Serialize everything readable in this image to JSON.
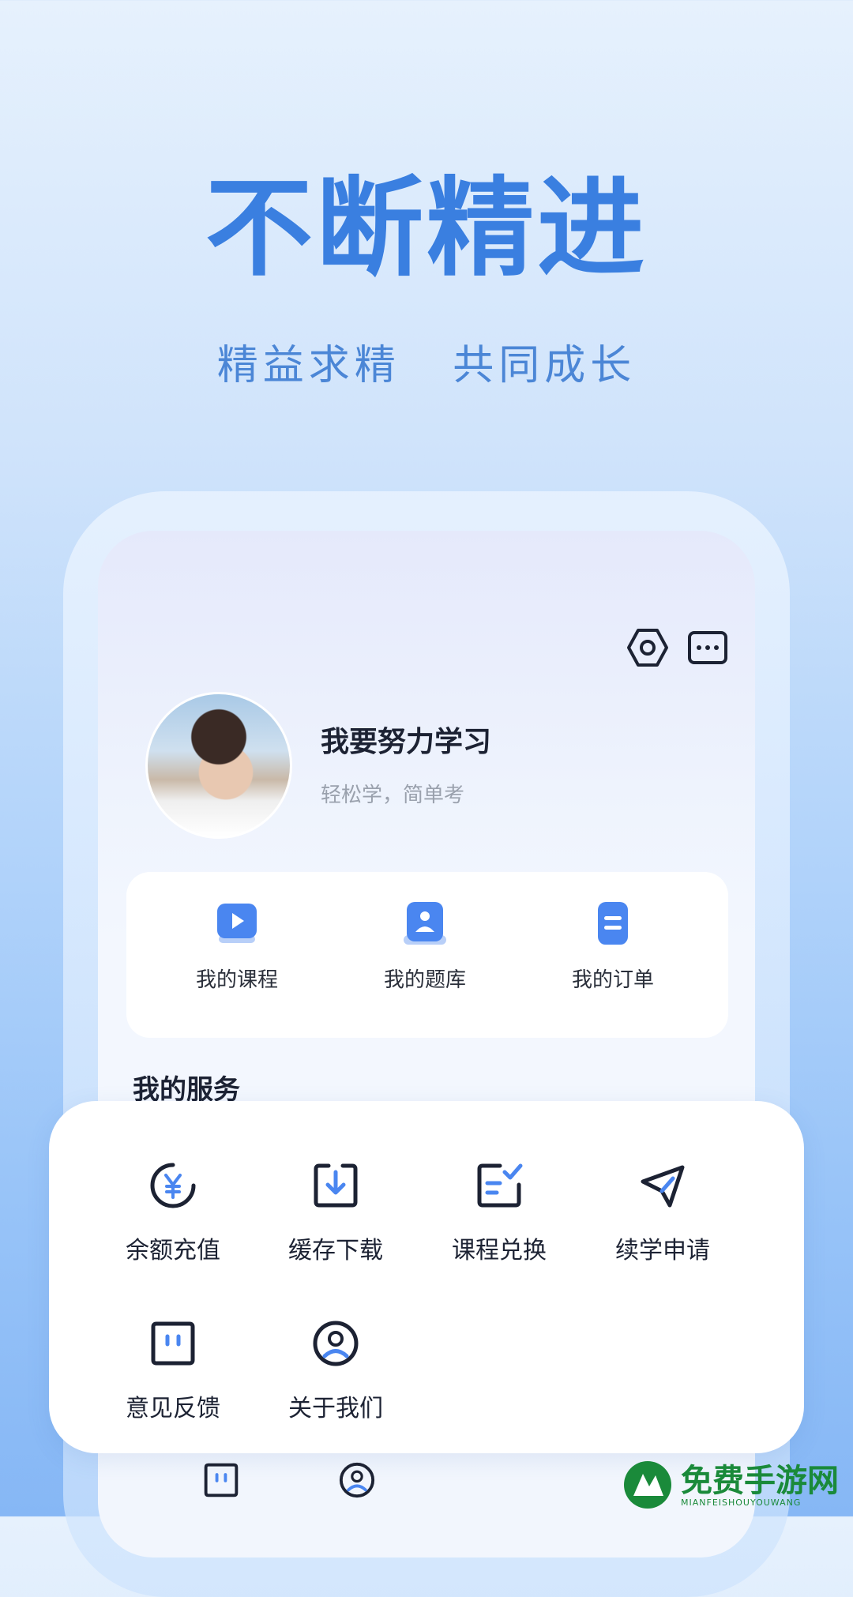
{
  "hero": {
    "title": "不断精进",
    "subtitle_part1": "精益求精",
    "subtitle_part2": "共同成长"
  },
  "header_icons": [
    "settings-icon",
    "more-icon"
  ],
  "profile": {
    "name": "我要努力学习",
    "tagline": "轻松学，简单考"
  },
  "quick_actions": [
    {
      "label": "我的课程",
      "icon": "play-icon"
    },
    {
      "label": "我的题库",
      "icon": "person-card-icon"
    },
    {
      "label": "我的订单",
      "icon": "order-icon"
    }
  ],
  "services": {
    "title": "我的服务",
    "items": [
      {
        "label": "余额充值",
        "icon": "yuan-coin-icon"
      },
      {
        "label": "缓存下载",
        "icon": "download-icon"
      },
      {
        "label": "课程兑换",
        "icon": "exchange-check-icon"
      },
      {
        "label": "续学申请",
        "icon": "paper-plane-icon"
      },
      {
        "label": "意见反馈",
        "icon": "feedback-icon"
      },
      {
        "label": "关于我们",
        "icon": "about-user-icon"
      }
    ]
  },
  "watermark": {
    "title": "免费手游网",
    "subtitle": "MIANFEISHOUYOUWANG"
  },
  "colors": {
    "accent": "#3a7fe0",
    "icon_blue": "#4a86f0",
    "text_dark": "#1c2233",
    "text_muted": "#9aa1ad",
    "watermark_green": "#1a8a3a"
  }
}
